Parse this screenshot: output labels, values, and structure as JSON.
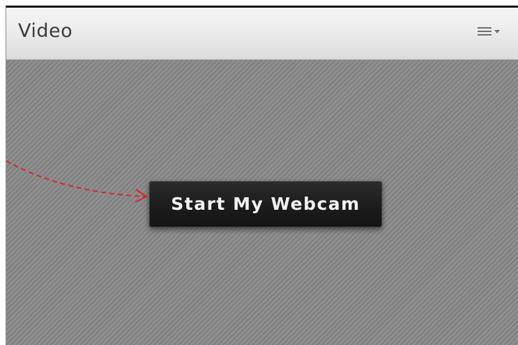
{
  "pod": {
    "title": "Video",
    "menu_icon": "options-menu-icon"
  },
  "main": {
    "start_button_label": "Start My Webcam"
  },
  "colors": {
    "annotation_arrow": "#d9262b",
    "button_background": "#1c1c1c",
    "body_background": "#8d8d8d"
  }
}
